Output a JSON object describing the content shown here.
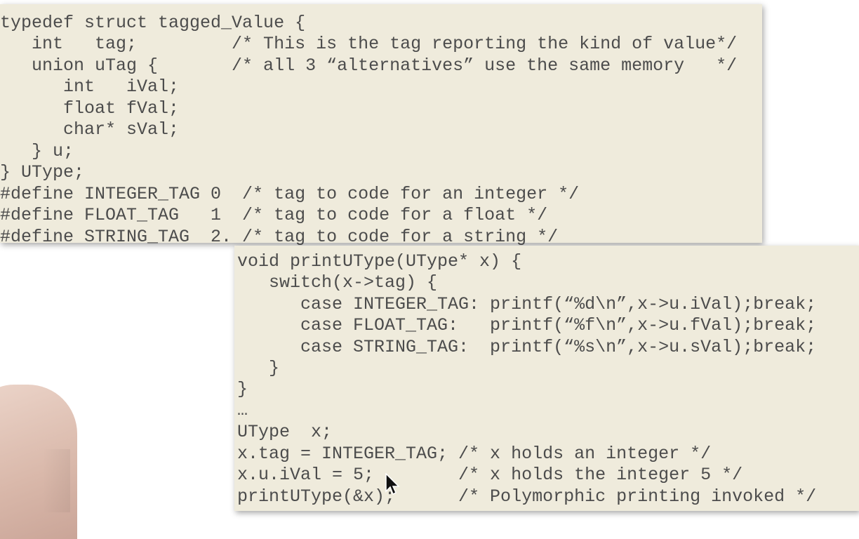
{
  "top_code": [
    "typedef struct tagged_Value {",
    "   int   tag;         /* This is the tag reporting the kind of value*/",
    "   union uTag {       /* all 3 “alternatives” use the same memory   */",
    "      int   iVal;",
    "      float fVal;",
    "      char* sVal;",
    "   } u;",
    "} UType;",
    "#define INTEGER_TAG 0  /* tag to code for an integer */",
    "#define FLOAT_TAG   1  /* tag to code for a float */",
    "#define STRING_TAG  2. /* tag to code for a string */"
  ],
  "bottom_code": [
    "void printUType(UType* x) {",
    "   switch(x->tag) {",
    "      case INTEGER_TAG: printf(“%d\\n”,x->u.iVal);break;",
    "      case FLOAT_TAG:   printf(“%f\\n”,x->u.fVal);break;",
    "      case STRING_TAG:  printf(“%s\\n”,x->u.sVal);break;",
    "   }",
    "}",
    "…",
    "UType  x;",
    "x.tag = INTEGER_TAG; /* x holds an integer */",
    "x.u.iVal = 5;        /* x holds the integer 5 */",
    "printUType(&x);      /* Polymorphic printing invoked */"
  ],
  "colors": {
    "card_background": "#efebdc",
    "code_text": "#4c4c4c",
    "page_background": "#ffffff"
  }
}
